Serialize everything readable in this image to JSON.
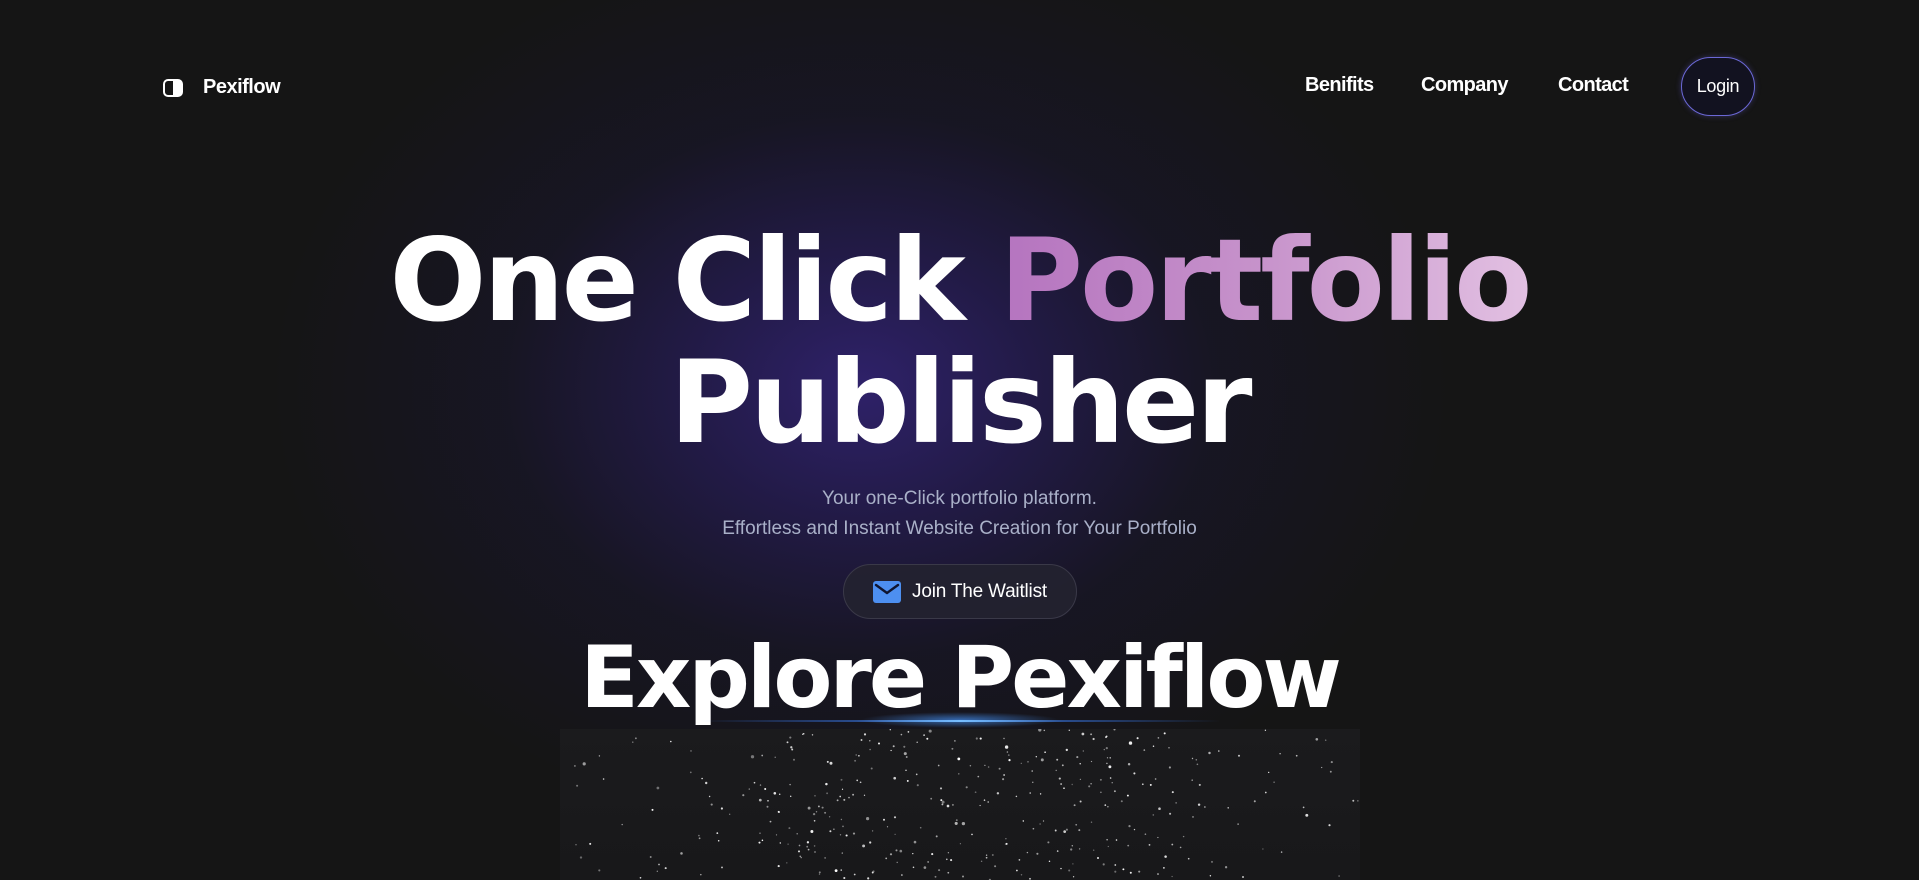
{
  "brand": {
    "name": "Pexiflow",
    "icon": "half-circle-logo-icon"
  },
  "nav": {
    "links": [
      "Benifits",
      "Company",
      "Contact"
    ],
    "login_label": "Login"
  },
  "hero": {
    "title_part1": "One Click ",
    "title_accent": "Portfolio",
    "title_line2": "Publisher",
    "subtitle_line1": "Your one-Click portfolio platform.",
    "subtitle_line2": "Effortless and Instant Website Creation for Your Portfolio",
    "cta_label": "Join The Waitlist",
    "cta_icon": "mail-icon"
  },
  "explore": {
    "title": "Explore Pexiflow"
  },
  "colors": {
    "background": "#151515",
    "accent_gradient_start": "#b574bf",
    "accent_gradient_end": "#e2c0e2",
    "login_border": "#6b68d6",
    "mail_icon": "#4d8ff0",
    "subtitle": "#a9b0c8"
  }
}
